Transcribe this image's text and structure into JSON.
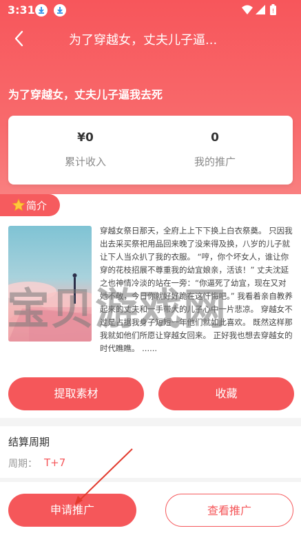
{
  "status_bar": {
    "time": "3:31"
  },
  "navbar": {
    "title": "为了穿越女，丈夫儿子逼..."
  },
  "book": {
    "name": "为了穿越女，丈夫儿子逼我去死"
  },
  "stats": {
    "income_value": "¥0",
    "income_label": "累计收入",
    "promo_value": "0",
    "promo_label": "我的推广"
  },
  "intro": {
    "tag_label": "简介",
    "synopsis": "穿越女祭日那天，全府上上下下换上白衣祭奠。 只因我出去采买祭祀用品回来晚了没来得及换，八岁的儿子就让下人当众扒了我的衣服。 “哼，你个坏女人，谁让你穿的花枝招展不尊重我的幼宜娘亲，活该！” 丈夫沈延之也神情冷淡的站在一旁：“你逼死了幼宜，现在又对她不敬，今日你就好好跪在这忏悔吧。” 我看着亲自教养起来的丈夫和一手带大的儿子心中一片悲凉。 穿越女不过是占据我身子短短一年他们就如此喜欢。 既然这样那我就如他们所愿让穿越女回来。 正好我也想去穿越女的时代瞧瞧。 ......"
  },
  "actions": {
    "extract_label": "提取素材",
    "collect_label": "收藏"
  },
  "settlement": {
    "title": "结算周期",
    "period_label": "周期：",
    "period_value": "T+7"
  },
  "bottom": {
    "apply_label": "申请推广",
    "view_label": "查看推广"
  },
  "watermark": {
    "text": "宝贝游戏网"
  },
  "colors": {
    "accent": "#f5575a",
    "header_top": "#f7565b",
    "header_bottom": "#f98383"
  },
  "icons": [
    "download-icon",
    "wifi-icon",
    "signal-icon",
    "battery-icon",
    "back-arrow-icon",
    "star-icon"
  ]
}
